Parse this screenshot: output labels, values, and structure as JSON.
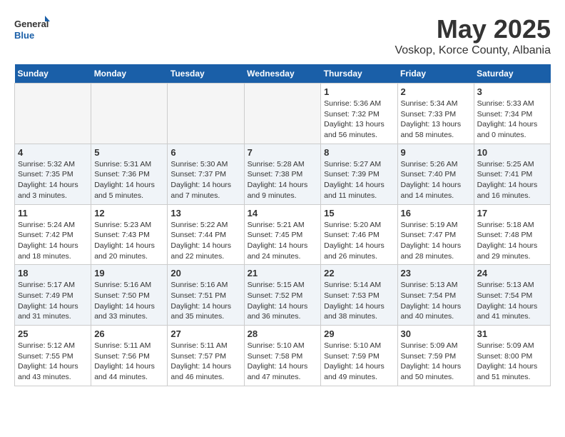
{
  "header": {
    "logo_general": "General",
    "logo_blue": "Blue",
    "month": "May 2025",
    "location": "Voskop, Korce County, Albania"
  },
  "days_of_week": [
    "Sunday",
    "Monday",
    "Tuesday",
    "Wednesday",
    "Thursday",
    "Friday",
    "Saturday"
  ],
  "weeks": [
    [
      {
        "day": "",
        "info": ""
      },
      {
        "day": "",
        "info": ""
      },
      {
        "day": "",
        "info": ""
      },
      {
        "day": "",
        "info": ""
      },
      {
        "day": "1",
        "info": "Sunrise: 5:36 AM\nSunset: 7:32 PM\nDaylight: 13 hours\nand 56 minutes."
      },
      {
        "day": "2",
        "info": "Sunrise: 5:34 AM\nSunset: 7:33 PM\nDaylight: 13 hours\nand 58 minutes."
      },
      {
        "day": "3",
        "info": "Sunrise: 5:33 AM\nSunset: 7:34 PM\nDaylight: 14 hours\nand 0 minutes."
      }
    ],
    [
      {
        "day": "4",
        "info": "Sunrise: 5:32 AM\nSunset: 7:35 PM\nDaylight: 14 hours\nand 3 minutes."
      },
      {
        "day": "5",
        "info": "Sunrise: 5:31 AM\nSunset: 7:36 PM\nDaylight: 14 hours\nand 5 minutes."
      },
      {
        "day": "6",
        "info": "Sunrise: 5:30 AM\nSunset: 7:37 PM\nDaylight: 14 hours\nand 7 minutes."
      },
      {
        "day": "7",
        "info": "Sunrise: 5:28 AM\nSunset: 7:38 PM\nDaylight: 14 hours\nand 9 minutes."
      },
      {
        "day": "8",
        "info": "Sunrise: 5:27 AM\nSunset: 7:39 PM\nDaylight: 14 hours\nand 11 minutes."
      },
      {
        "day": "9",
        "info": "Sunrise: 5:26 AM\nSunset: 7:40 PM\nDaylight: 14 hours\nand 14 minutes."
      },
      {
        "day": "10",
        "info": "Sunrise: 5:25 AM\nSunset: 7:41 PM\nDaylight: 14 hours\nand 16 minutes."
      }
    ],
    [
      {
        "day": "11",
        "info": "Sunrise: 5:24 AM\nSunset: 7:42 PM\nDaylight: 14 hours\nand 18 minutes."
      },
      {
        "day": "12",
        "info": "Sunrise: 5:23 AM\nSunset: 7:43 PM\nDaylight: 14 hours\nand 20 minutes."
      },
      {
        "day": "13",
        "info": "Sunrise: 5:22 AM\nSunset: 7:44 PM\nDaylight: 14 hours\nand 22 minutes."
      },
      {
        "day": "14",
        "info": "Sunrise: 5:21 AM\nSunset: 7:45 PM\nDaylight: 14 hours\nand 24 minutes."
      },
      {
        "day": "15",
        "info": "Sunrise: 5:20 AM\nSunset: 7:46 PM\nDaylight: 14 hours\nand 26 minutes."
      },
      {
        "day": "16",
        "info": "Sunrise: 5:19 AM\nSunset: 7:47 PM\nDaylight: 14 hours\nand 28 minutes."
      },
      {
        "day": "17",
        "info": "Sunrise: 5:18 AM\nSunset: 7:48 PM\nDaylight: 14 hours\nand 29 minutes."
      }
    ],
    [
      {
        "day": "18",
        "info": "Sunrise: 5:17 AM\nSunset: 7:49 PM\nDaylight: 14 hours\nand 31 minutes."
      },
      {
        "day": "19",
        "info": "Sunrise: 5:16 AM\nSunset: 7:50 PM\nDaylight: 14 hours\nand 33 minutes."
      },
      {
        "day": "20",
        "info": "Sunrise: 5:16 AM\nSunset: 7:51 PM\nDaylight: 14 hours\nand 35 minutes."
      },
      {
        "day": "21",
        "info": "Sunrise: 5:15 AM\nSunset: 7:52 PM\nDaylight: 14 hours\nand 36 minutes."
      },
      {
        "day": "22",
        "info": "Sunrise: 5:14 AM\nSunset: 7:53 PM\nDaylight: 14 hours\nand 38 minutes."
      },
      {
        "day": "23",
        "info": "Sunrise: 5:13 AM\nSunset: 7:54 PM\nDaylight: 14 hours\nand 40 minutes."
      },
      {
        "day": "24",
        "info": "Sunrise: 5:13 AM\nSunset: 7:54 PM\nDaylight: 14 hours\nand 41 minutes."
      }
    ],
    [
      {
        "day": "25",
        "info": "Sunrise: 5:12 AM\nSunset: 7:55 PM\nDaylight: 14 hours\nand 43 minutes."
      },
      {
        "day": "26",
        "info": "Sunrise: 5:11 AM\nSunset: 7:56 PM\nDaylight: 14 hours\nand 44 minutes."
      },
      {
        "day": "27",
        "info": "Sunrise: 5:11 AM\nSunset: 7:57 PM\nDaylight: 14 hours\nand 46 minutes."
      },
      {
        "day": "28",
        "info": "Sunrise: 5:10 AM\nSunset: 7:58 PM\nDaylight: 14 hours\nand 47 minutes."
      },
      {
        "day": "29",
        "info": "Sunrise: 5:10 AM\nSunset: 7:59 PM\nDaylight: 14 hours\nand 49 minutes."
      },
      {
        "day": "30",
        "info": "Sunrise: 5:09 AM\nSunset: 7:59 PM\nDaylight: 14 hours\nand 50 minutes."
      },
      {
        "day": "31",
        "info": "Sunrise: 5:09 AM\nSunset: 8:00 PM\nDaylight: 14 hours\nand 51 minutes."
      }
    ]
  ]
}
